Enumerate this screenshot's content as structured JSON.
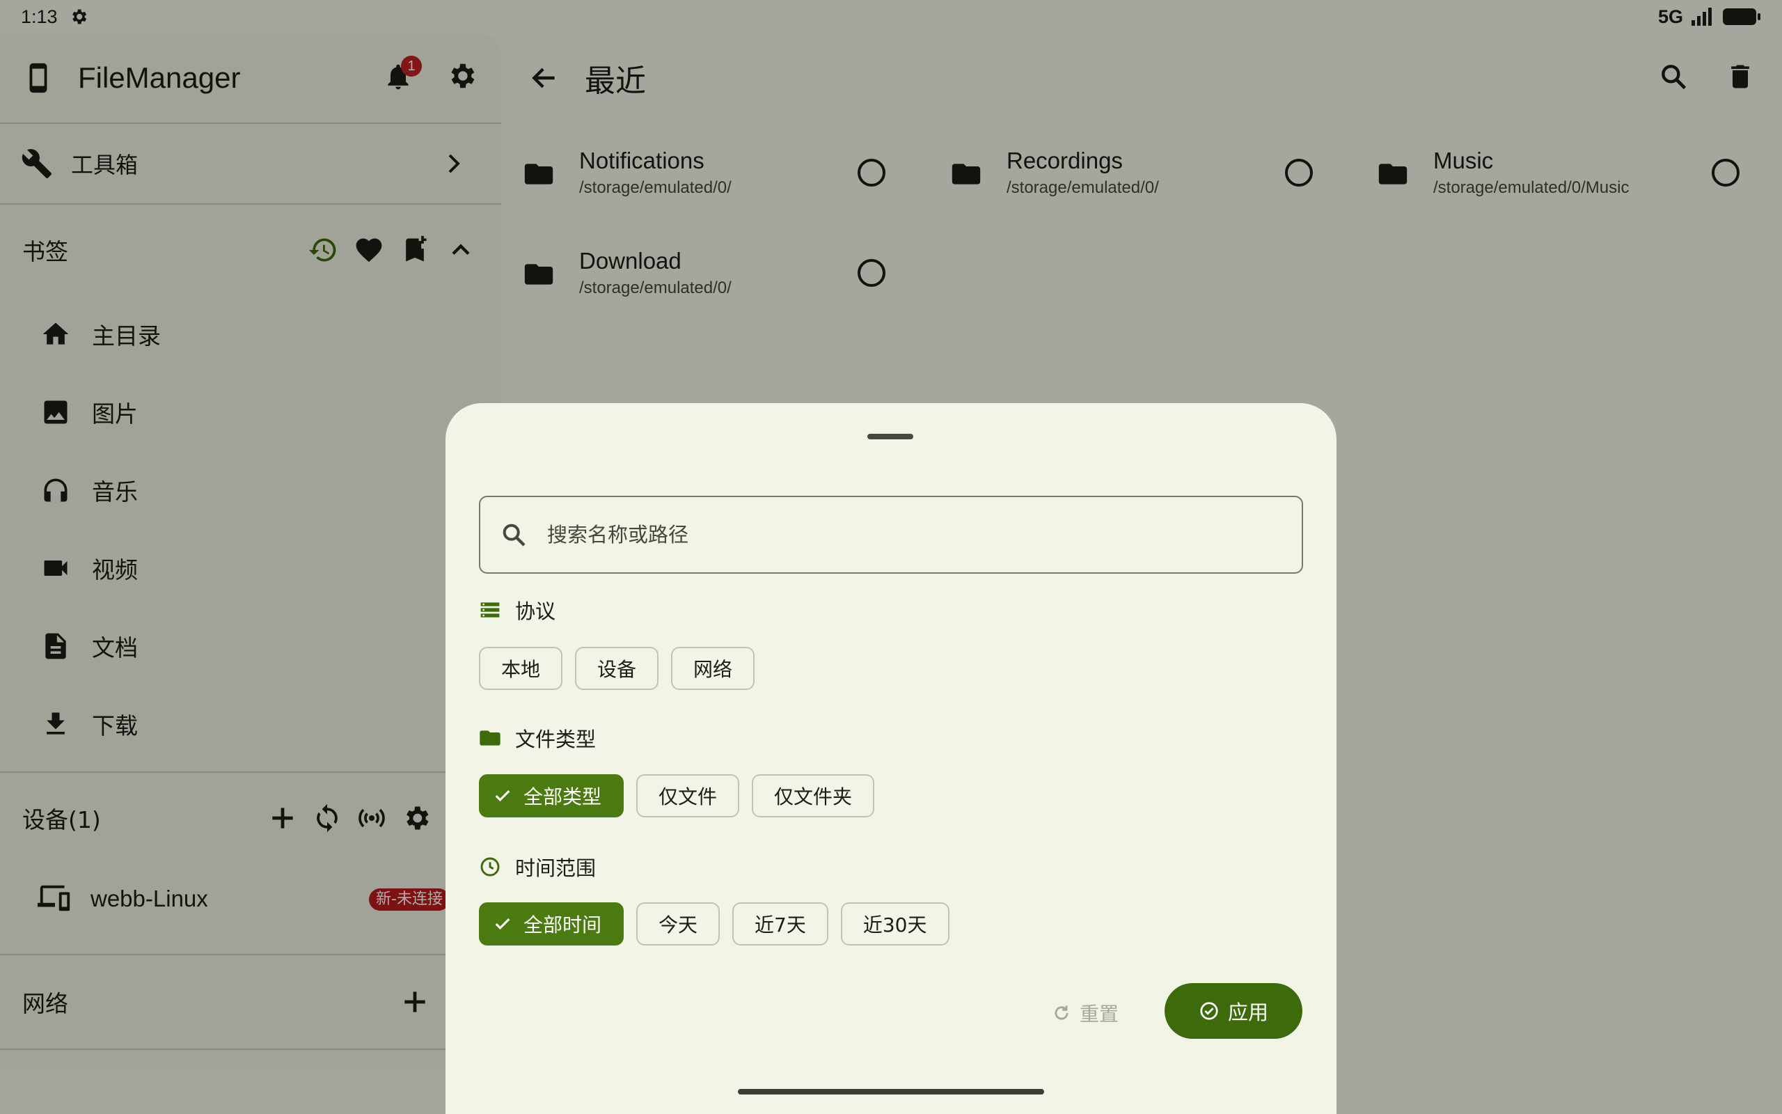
{
  "status_bar": {
    "time": "1:13",
    "network": "5G"
  },
  "drawer": {
    "app_title": "FileManager",
    "notification_count": "1",
    "toolbox_label": "工具箱",
    "bookmarks_title": "书签",
    "bookmarks": [
      {
        "label": "主目录",
        "icon": "home-icon"
      },
      {
        "label": "图片",
        "icon": "image-icon"
      },
      {
        "label": "音乐",
        "icon": "headphones-icon"
      },
      {
        "label": "视频",
        "icon": "video-icon"
      },
      {
        "label": "文档",
        "icon": "document-icon"
      },
      {
        "label": "下载",
        "icon": "download-icon"
      }
    ],
    "devices_title": "设备(1)",
    "device_name": "webb-Linux",
    "device_badge": "新-未连接",
    "network_title": "网络"
  },
  "main": {
    "title": "最近",
    "recent": [
      {
        "name": "Notifications",
        "path": "/storage/emulated/0/"
      },
      {
        "name": "Recordings",
        "path": "/storage/emulated/0/"
      },
      {
        "name": "Music",
        "path": "/storage/emulated/0/Music"
      },
      {
        "name": "Download",
        "path": "/storage/emulated/0/"
      }
    ]
  },
  "sheet": {
    "search_placeholder": "搜索名称或路径",
    "protocol_title": "协议",
    "protocol_chips": [
      "本地",
      "设备",
      "网络"
    ],
    "filetype_title": "文件类型",
    "filetype_chips": [
      "全部类型",
      "仅文件",
      "仅文件夹"
    ],
    "filetype_selected": "全部类型",
    "time_title": "时间范围",
    "time_chips": [
      "全部时间",
      "今天",
      "近7天",
      "近30天"
    ],
    "time_selected": "全部时间",
    "reset_label": "重置",
    "apply_label": "应用"
  },
  "colors": {
    "accent": "#4b7a10",
    "apply": "#3d6a0a",
    "badge": "#ba1a1a",
    "surface": "#f1f4e6"
  }
}
